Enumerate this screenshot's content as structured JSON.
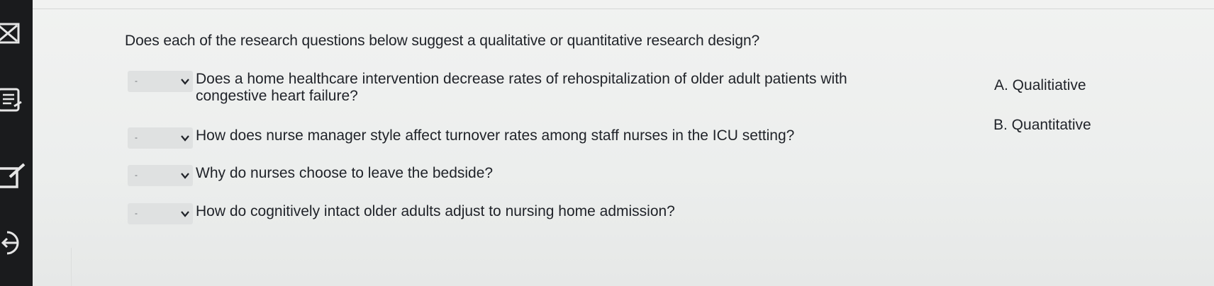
{
  "question": {
    "title": "Does each of the research questions below suggest a qualitative or quantitative research design?"
  },
  "items": [
    {
      "selected": "-",
      "text_line1": "Does a home healthcare intervention decrease rates of rehospitalization of older adult patients with",
      "text_line2": "congestive heart failure?"
    },
    {
      "selected": "-",
      "text_line1": "How does nurse manager style affect turnover rates among staff nurses in the ICU setting?"
    },
    {
      "selected": "-",
      "text_line1": "Why do nurses choose to leave the bedside?"
    },
    {
      "selected": "-",
      "text_line1": "How do cognitively intact older adults adjust to nursing home admission?"
    }
  ],
  "options": [
    {
      "label": "A. Qualitiative"
    },
    {
      "label": "B. Quantitative"
    }
  ],
  "sidebar": {
    "icons": [
      "close-box-icon",
      "notes-icon",
      "edit-icon",
      "exit-icon"
    ]
  }
}
